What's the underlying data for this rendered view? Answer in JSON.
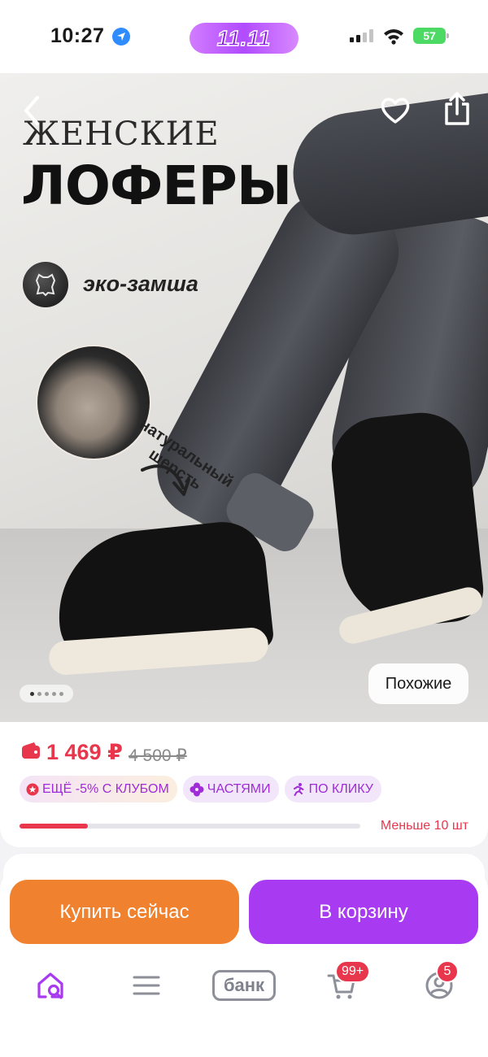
{
  "status_bar": {
    "time": "10:27",
    "promo_label": "11.11",
    "battery_level": "57"
  },
  "hero": {
    "title_small": "ЖЕНСКИЕ",
    "title_big": "ЛОФЕРЫ",
    "material_label": "эко-замша",
    "wool_label_line1": "натуральный",
    "wool_label_line2": "шерсть",
    "similar_button": "Похожие",
    "carousel_total": 5,
    "carousel_active": 1
  },
  "price": {
    "current": "1 469 ₽",
    "old": "4 500 ₽",
    "chips": [
      {
        "label": "ЕЩЁ -5% С КЛУБОМ",
        "icon": "club-star-icon"
      },
      {
        "label": "ЧАСТЯМИ",
        "icon": "clover-icon"
      },
      {
        "label": "ПО КЛИКУ",
        "icon": "running-person-icon"
      }
    ],
    "stock_label": "Меньше 10 шт",
    "stock_fraction": 0.2
  },
  "actions": {
    "buy_now": "Купить сейчас",
    "to_cart": "В корзину"
  },
  "tab_bar": {
    "home_icon": "home-search-icon",
    "catalog_icon": "menu-lines-icon",
    "bank_label": "банк",
    "cart_badge": "99+",
    "profile_badge": "5"
  },
  "colors": {
    "accent_purple": "#a83af1",
    "accent_orange": "#f0812f",
    "price_red": "#e8374d"
  }
}
